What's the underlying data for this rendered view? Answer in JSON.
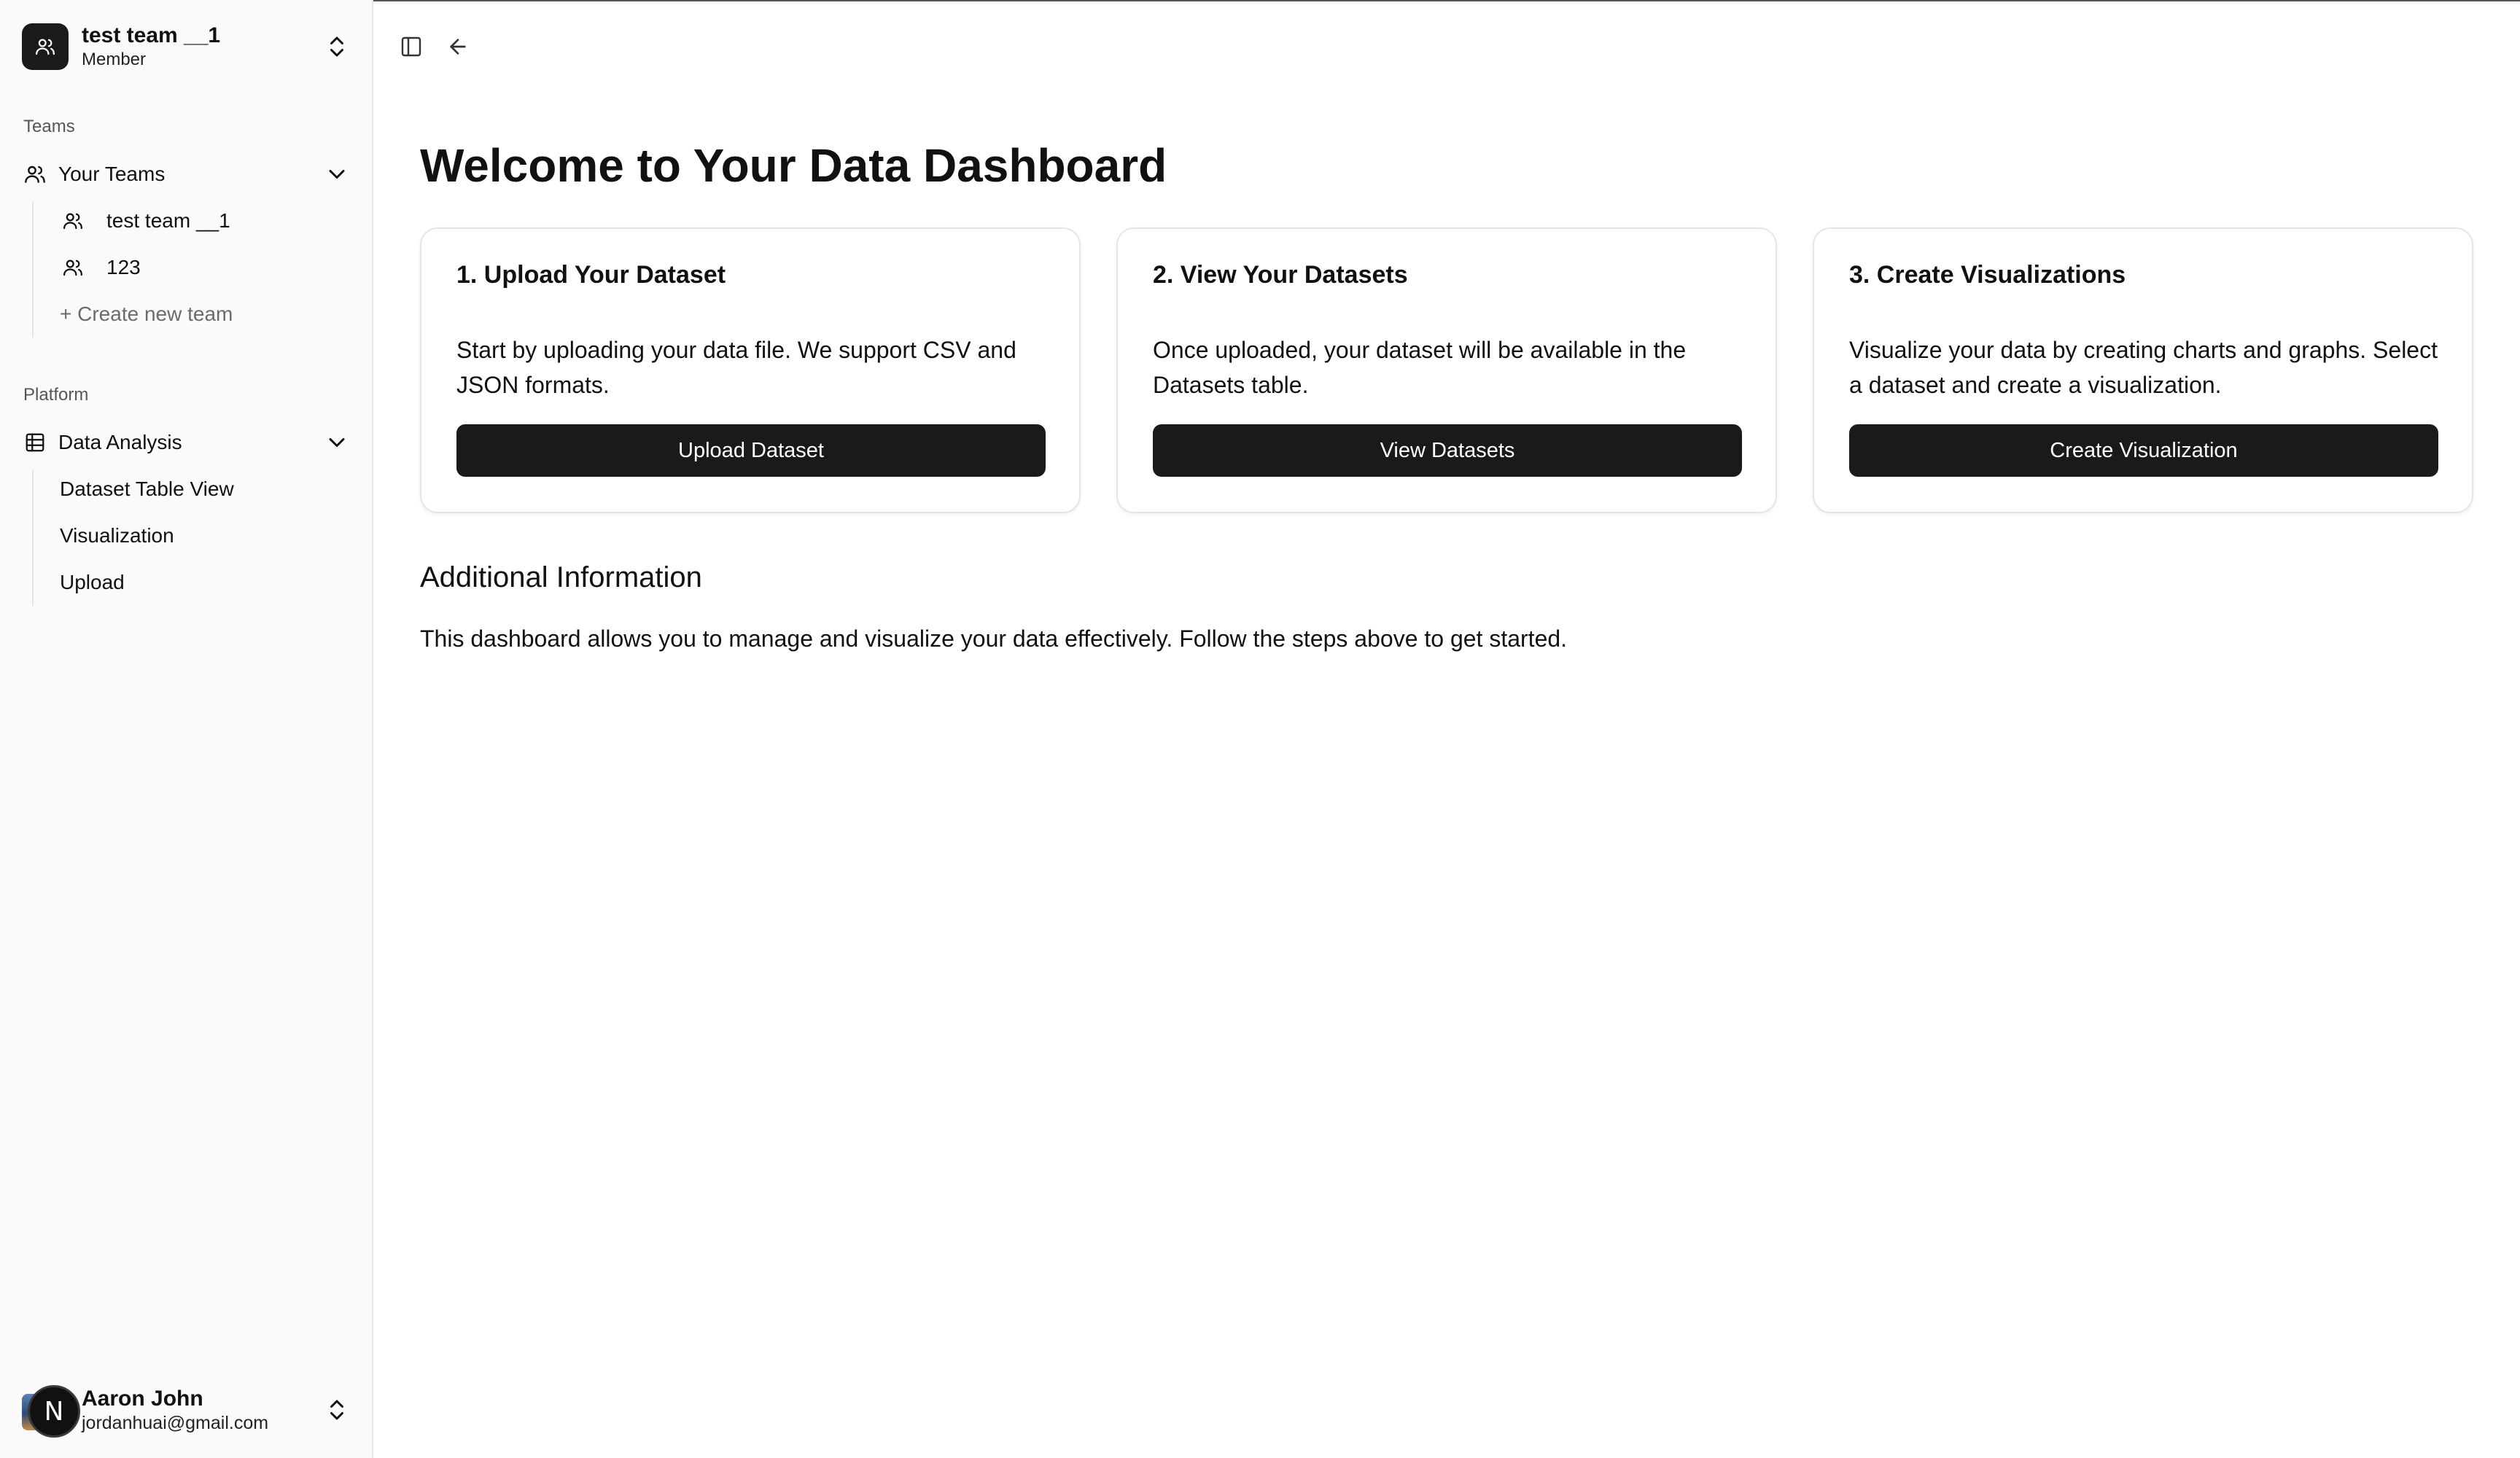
{
  "sidebar": {
    "team_switcher": {
      "name": "test team __1",
      "role": "Member"
    },
    "groups": [
      {
        "label": "Teams",
        "item": {
          "label": "Your Teams",
          "icon": "users-icon"
        },
        "children": [
          {
            "label": "test team __1",
            "icon": "users-icon"
          },
          {
            "label": "123",
            "icon": "users-icon"
          },
          {
            "label": "+ Create new team"
          }
        ]
      },
      {
        "label": "Platform",
        "item": {
          "label": "Data Analysis",
          "icon": "table-icon"
        },
        "children": [
          {
            "label": "Dataset Table View"
          },
          {
            "label": "Visualization"
          },
          {
            "label": "Upload"
          }
        ]
      }
    ],
    "user": {
      "name": "Aaron John",
      "email": "jordanhuai@gmail.com",
      "badge": "N"
    }
  },
  "main": {
    "title": "Welcome to Your Data Dashboard",
    "cards": [
      {
        "title": "1. Upload Your Dataset",
        "description": "Start by uploading your data file. We support CSV and JSON formats.",
        "button": "Upload Dataset"
      },
      {
        "title": "2. View Your Datasets",
        "description": "Once uploaded, your dataset will be available in the Datasets table.",
        "button": "View Datasets"
      },
      {
        "title": "3. Create Visualizations",
        "description": "Visualize your data by creating charts and graphs. Select a dataset and create a visualization.",
        "button": "Create Visualization"
      }
    ],
    "additional": {
      "heading": "Additional Information",
      "body": "This dashboard allows you to manage and visualize your data effectively. Follow the steps above to get started."
    }
  },
  "colors": {
    "primary_button": "#1a1a1a",
    "sidebar_bg": "#fafafa",
    "border": "#e6e6e6",
    "muted_text": "#6b6b6b"
  }
}
